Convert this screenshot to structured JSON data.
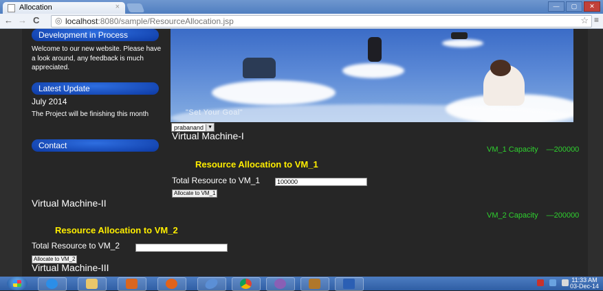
{
  "browser": {
    "tab_title": "Allocation",
    "tab_close": "×",
    "url_host": "localhost",
    "url_rest": ":8080/sample/ResourceAllocation.jsp",
    "back": "←",
    "forward": "→",
    "reload": "C",
    "star": "☆",
    "window_buttons": [
      "—",
      "▢",
      "✕"
    ]
  },
  "sidebar": {
    "dev_heading": "Development in Process",
    "welcome_text": "Welcome to our new website. Please have a look around, any feedback is much appreciated.",
    "latest_heading": "Latest Update",
    "latest_date": "July 2014",
    "latest_text": "The Project will be finishing this month",
    "contact_heading": "Contact"
  },
  "banner": {
    "tagline": "\"Set Your Goal\""
  },
  "user_select": {
    "value": "prabanand"
  },
  "vm1": {
    "title": "Virtual Machine-I",
    "capacity_label": "VM_1 Capacity",
    "capacity_value": "200000",
    "heading": "Resource Allocation to VM_1",
    "total_label": "Total Resource to VM_1",
    "total_value": "100000",
    "button": "Allocate to VM_1"
  },
  "vm2": {
    "title": "Virtual Machine-II",
    "capacity_label": "VM_2 Capacity",
    "capacity_value": "200000",
    "heading": "Resource Allocation to VM_2",
    "total_label": "Total Resource to VM_2",
    "total_value": "",
    "button": "Allocate to VM_2"
  },
  "vm3": {
    "title": "Virtual Machine-III"
  },
  "taskbar": {
    "apps": [
      "start-button",
      "ie-icon",
      "explorer-icon",
      "media-player-icon",
      "firefox-icon",
      "eclipse-icon",
      "chrome-icon",
      "app-icon",
      "tomcat-icon",
      "word-icon"
    ],
    "time": "11:33 AM",
    "date": "03-Dec-14"
  },
  "colors": {
    "page_bg": "#262626",
    "pill_blue": "#1553c7",
    "capacity_green": "#2fd22f",
    "heading_yellow": "#ffee00"
  }
}
